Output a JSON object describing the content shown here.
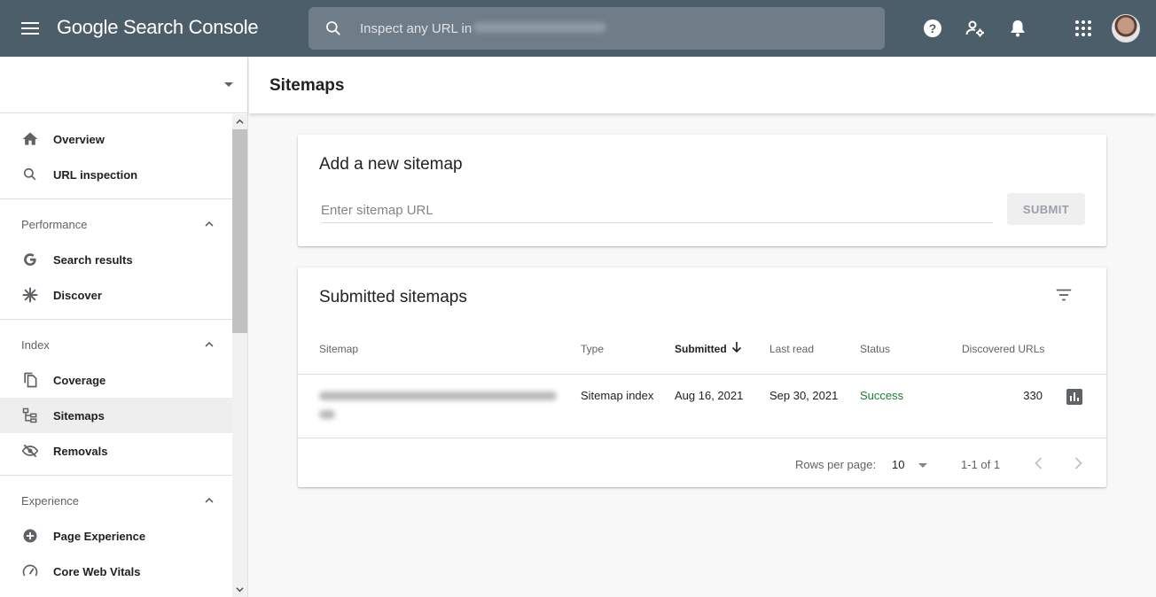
{
  "header": {
    "brand": "Google Search Console",
    "search_placeholder": "Inspect any URL in"
  },
  "sidebar": {
    "scroll_position": 0.0,
    "items": [
      {
        "label": "Overview"
      },
      {
        "label": "URL inspection"
      }
    ],
    "sections": [
      {
        "label": "Performance",
        "items": [
          {
            "label": "Search results"
          },
          {
            "label": "Discover"
          }
        ]
      },
      {
        "label": "Index",
        "items": [
          {
            "label": "Coverage"
          },
          {
            "label": "Sitemaps"
          },
          {
            "label": "Removals"
          }
        ]
      },
      {
        "label": "Experience",
        "items": [
          {
            "label": "Page Experience"
          },
          {
            "label": "Core Web Vitals"
          }
        ]
      }
    ]
  },
  "page": {
    "title": "Sitemaps"
  },
  "add_sitemap": {
    "title": "Add a new sitemap",
    "input_placeholder": "Enter sitemap URL",
    "submit_label": "SUBMIT"
  },
  "submitted": {
    "title": "Submitted sitemaps",
    "columns": [
      "Sitemap",
      "Type",
      "Submitted",
      "Last read",
      "Status",
      "Discovered URLs"
    ],
    "rows": [
      {
        "type": "Sitemap index",
        "submitted": "Aug 16, 2021",
        "last_read": "Sep 30, 2021",
        "status": "Success",
        "discovered": "330"
      }
    ],
    "footer": {
      "rows_per_page_label": "Rows per page:",
      "rows_per_page": "10",
      "range": "1-1 of 1"
    }
  },
  "colors": {
    "topbar": "#4d5e6b",
    "success": "#188038",
    "active_nav": "#eeeeee"
  }
}
